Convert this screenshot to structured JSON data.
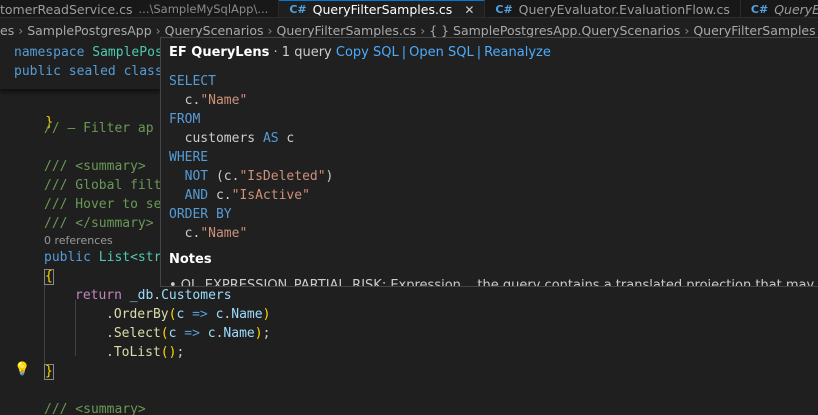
{
  "tabs": [
    {
      "name": "tomerReadService.cs",
      "desc": "...\\SampleMySqlApp\\...",
      "active": false
    },
    {
      "name": "QueryFilterSamples.cs",
      "desc": "",
      "active": true,
      "close": "✕"
    },
    {
      "name": "QueryEvaluator.EvaluationFlow.cs",
      "desc": "",
      "active": false
    },
    {
      "name": "QueryEvaluato",
      "desc": "",
      "active": false,
      "italic": true
    }
  ],
  "breadcrumb": [
    "es",
    "SamplePostgresApp",
    "QueryScenarios",
    "QueryFilterSamples.cs",
    "{ } SamplePostgresApp.QueryScenarios",
    "QueryFilterSamples"
  ],
  "code": {
    "line1_ns_kw": "namespace",
    "line1_ns": "SamplePos",
    "line2_mods": "public sealed class",
    "line3_brace": "}",
    "line5_comment": "// — Filter ap",
    "line7_summary": "/// <summary>",
    "line8": "/// Global filt",
    "line9": "/// Hover to se",
    "line10": "/// </summary>",
    "codelens": "0 references",
    "line11_kw": "public",
    "line11_type": "List<str",
    "line12_brace": "{",
    "line13_return": "return",
    "line13_db": "_db",
    "line13_customers": "Customers",
    "line14_method": "OrderBy",
    "line15_method": "Select",
    "line16_method": "ToList",
    "line17_brace": "}",
    "line19_summary": "/// <summary>"
  },
  "hover": {
    "title": "EF QueryLens",
    "count": "· 1 query",
    "copy_sql": "Copy SQL",
    "open_sql": "Open SQL",
    "reanalyze": "Reanalyze",
    "sep": "|",
    "notes_title": "Notes",
    "note1": "• QL_EXPRESSION_PARTIAL_RISK: Expression... the query contains a translated projection that may partially"
  },
  "sql": {
    "select": "SELECT",
    "alias_c": "c",
    "name_col": "\"Name\"",
    "from": "FROM",
    "table": "customers",
    "as": "AS",
    "where": "WHERE",
    "not": "NOT",
    "isdeleted": "\"IsDeleted\"",
    "and": "AND",
    "isactive": "\"IsActive\"",
    "orderby": "ORDER BY"
  },
  "icons": {
    "lightbulb": "lightbulb-icon",
    "csharp": "csharp-file-icon",
    "close": "close-icon"
  },
  "colors": {
    "link": "#4daafc",
    "keyword": "#569cd6",
    "string": "#ce9178",
    "type": "#4ec9b0",
    "comment": "#6a9955"
  }
}
